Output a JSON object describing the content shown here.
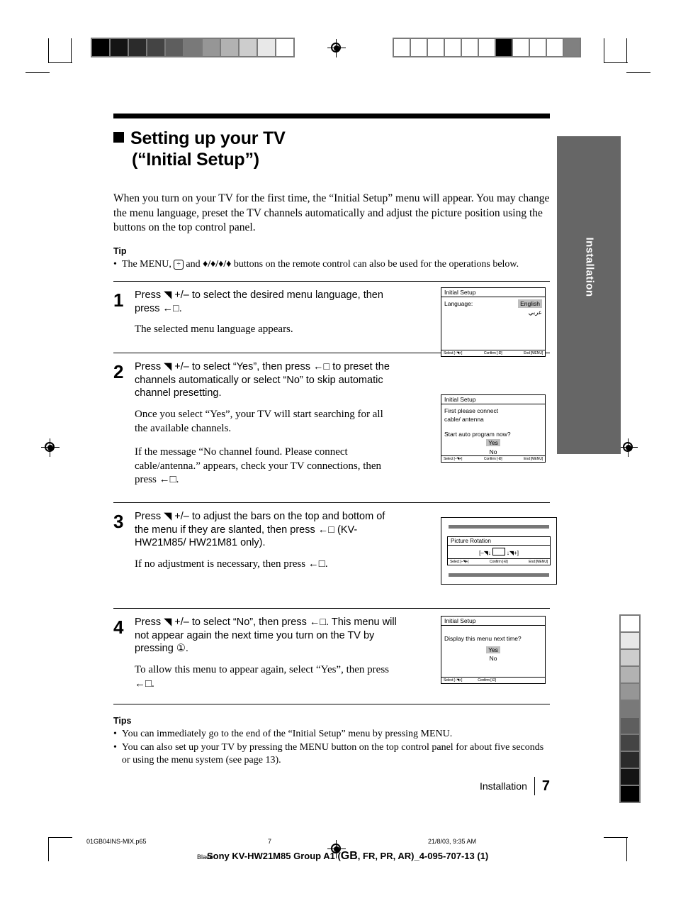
{
  "side_tab": {
    "label": "Installation"
  },
  "heading": {
    "line1": "Setting up your TV",
    "line2": "(“Initial Setup”)"
  },
  "intro": "When you turn on your TV for the first time, the “Initial Setup” menu will appear. You may change the menu language, preset the TV channels automatically and adjust the picture position using the buttons on the top control panel.",
  "tip": {
    "head": "Tip",
    "bullet_mark": "•",
    "text_before": "The MENU,",
    "jog_icon": "jog-dial-icon",
    "text_mid": "and",
    "arrows": "♦/♦/♦/♦",
    "text_after": "buttons on the remote control can also be used for the operations below."
  },
  "steps": [
    {
      "number": "1",
      "main": "Press ◥ +/– to select the desired menu language, then press ←□.",
      "sub1": "The selected menu language appears.",
      "sub2": ""
    },
    {
      "number": "2",
      "main": "Press ◥ +/– to select “Yes”, then press ←□ to preset the channels automatically or select “No” to skip automatic channel presetting.",
      "sub1": "Once you select “Yes”, your TV will start searching for all the available channels.",
      "sub2": "If the message “No channel found. Please connect cable/antenna.” appears, check your TV connections, then press ←□."
    },
    {
      "number": "3",
      "main": "Press ◥ +/–  to adjust the bars on the top and bottom of the menu if they are slanted, then press ←□ (KV-HW21M85/ HW21M81 only).",
      "sub1": "If no adjustment is necessary, then press ←□.",
      "sub2": ""
    },
    {
      "number": "4",
      "main": "Press ◥ +/–  to select “No”, then press ←□. This menu will not appear again the next time you turn on the TV by pressing ①.",
      "sub1": "To allow this menu to appear again, select “Yes”, then press ←□.",
      "sub2": ""
    }
  ],
  "osd": {
    "title": "Initial Setup",
    "footer": {
      "select": "Select [–◥+]",
      "confirm": "Confirm [·Ð]",
      "end": "End [MENU]"
    },
    "screen1": {
      "label": "Language:",
      "option_selected": "English",
      "option_other": "عربي"
    },
    "screen2": {
      "line1": "First please connect",
      "line2": "cable/ antenna",
      "line3": "Start auto program now?",
      "yes": "Yes",
      "no": "No"
    },
    "screen3": {
      "title": "Picture Rotation",
      "control": "[–◥↓ ↑◥+]",
      "footer": {
        "select": "Select [–◥+]",
        "confirm": "Confirm [·Ð]",
        "end": "End [MENU]"
      }
    },
    "screen4": {
      "question": "Display this menu next time?",
      "yes": "Yes",
      "no": "No",
      "footer": {
        "select": "Select [–◥+]",
        "confirm": "Confirm [·Ð]"
      }
    }
  },
  "tips": {
    "head": "Tips",
    "items": [
      "You can immediately go to the end of the “Initial Setup” menu by pressing MENU.",
      "You can also set up your TV by pressing the MENU button on the top control panel for about five seconds or using the menu system (see page 13)."
    ]
  },
  "footer": {
    "section": "Installation",
    "page_number": "7"
  },
  "print_footer": {
    "filename": "01GB04INS-MIX.p65",
    "page": "7",
    "timestamp": "21/8/03, 9:35 AM",
    "black": "Black",
    "doc_title_pre": "Sony KV-HW21M85 Group A1 (",
    "doc_title_gb": "GB",
    "doc_title_post": ", FR, PR, AR)_4-095-707-13 (1)"
  },
  "colors": {
    "tab_gray": "#666666",
    "highlight_gray": "#bfbfbf",
    "wedge_border": "#7a7a7a"
  },
  "wedge_top_left": [
    "#000000",
    "#141414",
    "#2b2b2b",
    "#444444",
    "#5e5e5e",
    "#797979",
    "#969696",
    "#b2b2b2",
    "#cdcdcd",
    "#e8e8e8",
    "#ffffff"
  ],
  "regbar_top_right": [
    "#ffffff",
    "#ffffff",
    "#ffffff",
    "#ffffff",
    "#ffffff",
    "#ffffff",
    "#000000",
    "#ffffff",
    "#ffffff",
    "#ffffff",
    "#808080"
  ],
  "wedge_right": [
    "#ffffff",
    "#e8e8e8",
    "#cdcdcd",
    "#b2b2b2",
    "#969696",
    "#797979",
    "#5e5e5e",
    "#444444",
    "#2b2b2b",
    "#141414",
    "#000000"
  ]
}
